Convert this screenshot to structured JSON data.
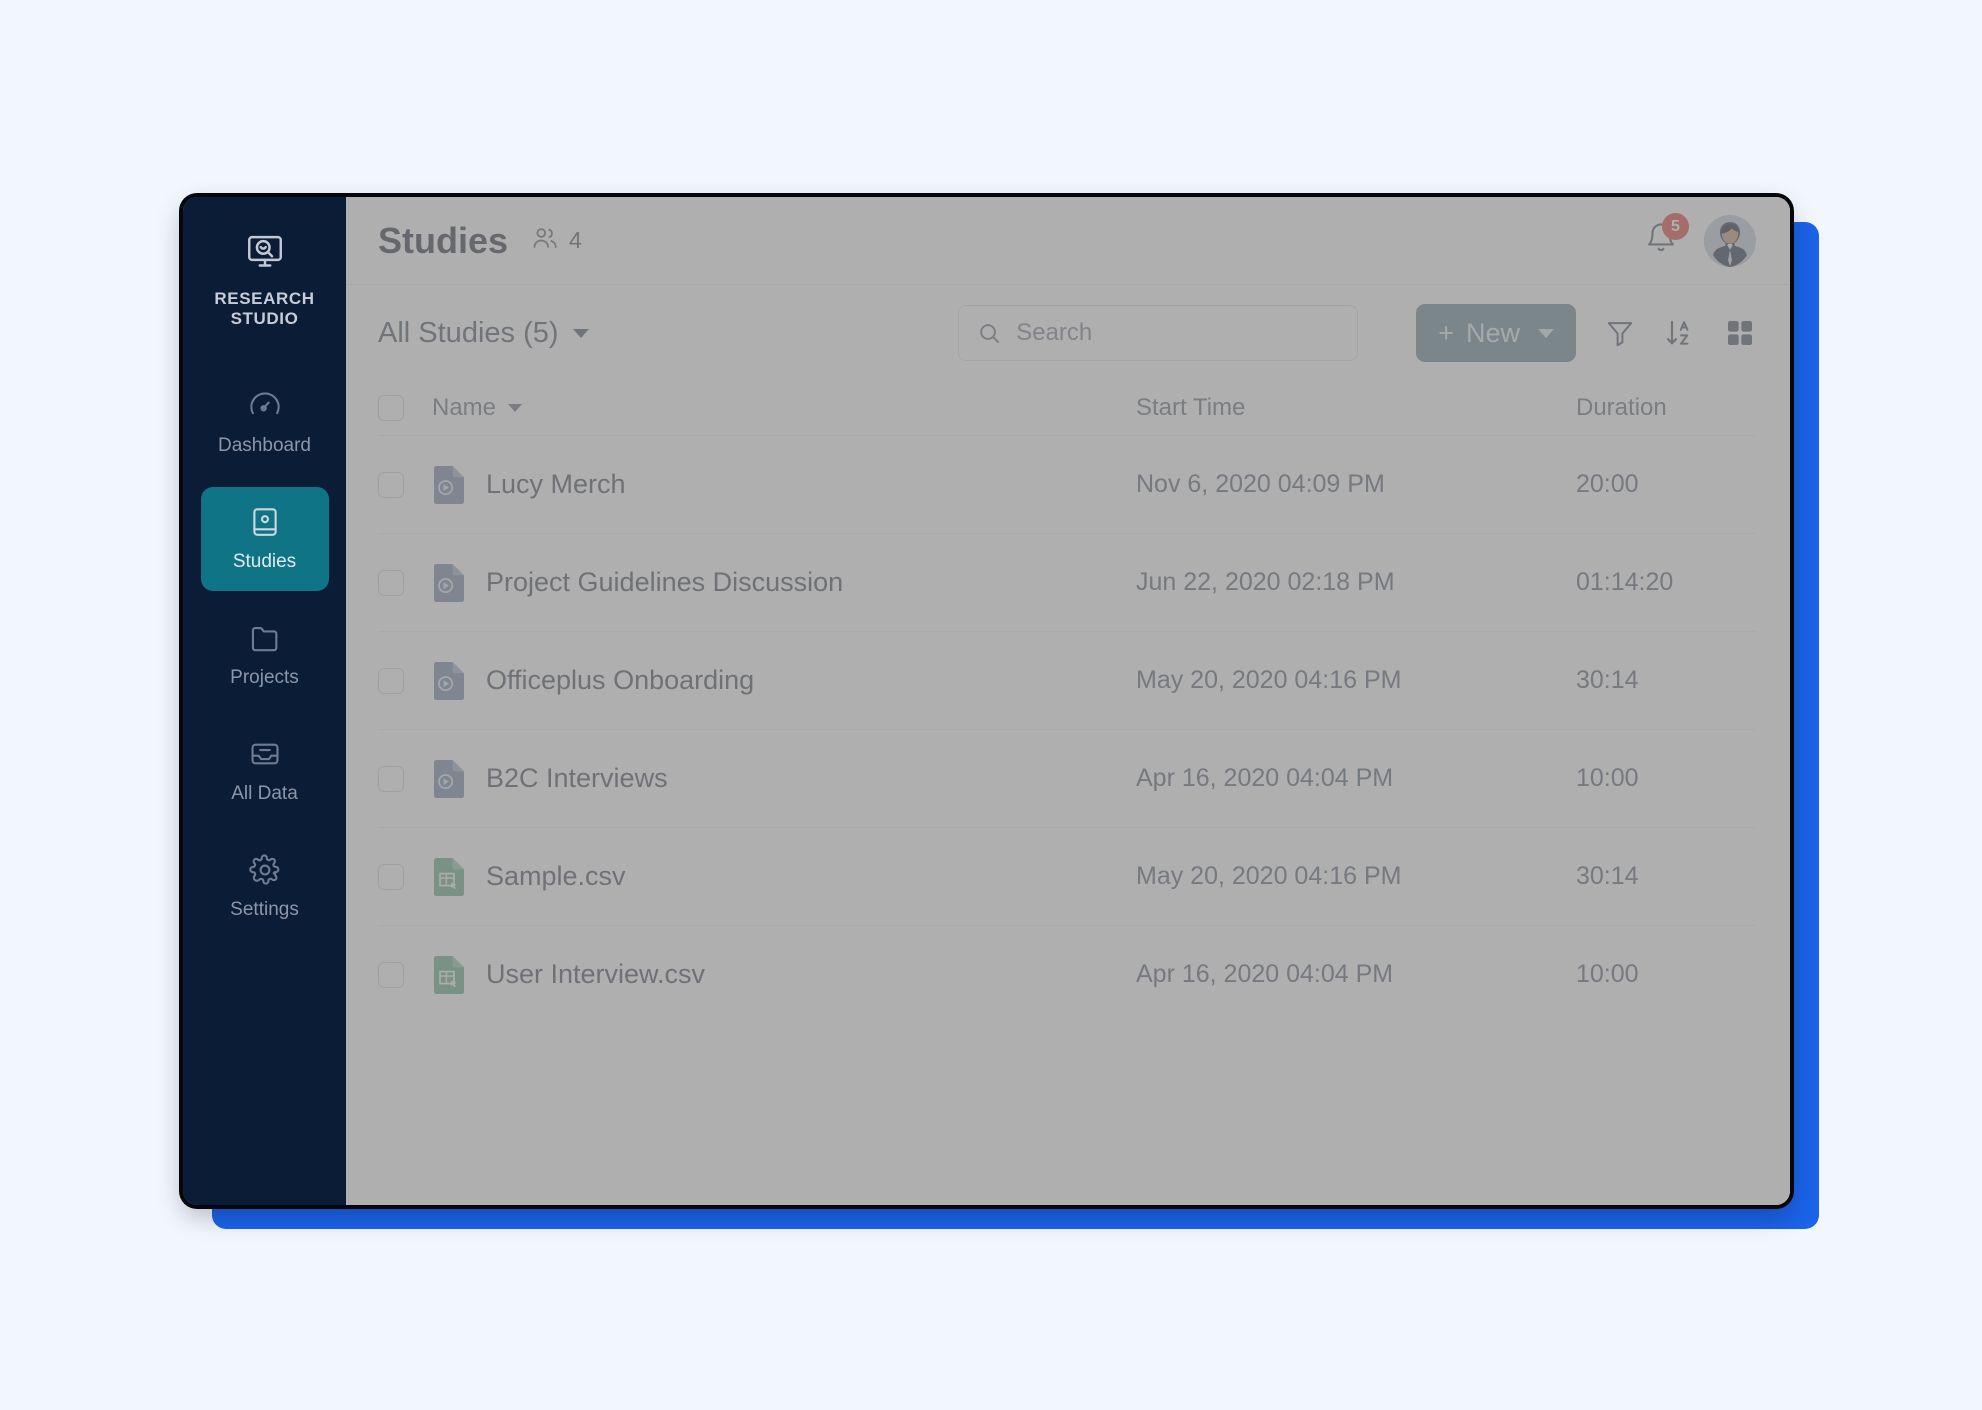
{
  "sidebar": {
    "brand": {
      "name": "RESEARCH\nSTUDIO",
      "icon": "research-studio-logo-icon"
    },
    "items": [
      {
        "label": "Dashboard",
        "icon": "speedometer-icon",
        "active": false
      },
      {
        "label": "Studies",
        "icon": "book-icon",
        "active": true
      },
      {
        "label": "Projects",
        "icon": "folder-icon",
        "active": false
      },
      {
        "label": "All Data",
        "icon": "inbox-icon",
        "active": false
      },
      {
        "label": "Settings",
        "icon": "gear-icon",
        "active": false
      }
    ]
  },
  "header": {
    "title": "Studies",
    "members_icon": "people-icon",
    "members_count": "4",
    "bell_icon": "bell-icon",
    "notification_count": "5",
    "avatar_icon": "user-avatar"
  },
  "toolbar": {
    "filter_label": "All Studies (5)",
    "search": {
      "placeholder": "Search",
      "value": "",
      "icon": "search-icon"
    },
    "new_button": {
      "label": "New",
      "plus": "+",
      "icon": "chevron-down-icon"
    },
    "icons": [
      {
        "name": "filter-icon"
      },
      {
        "name": "sort-az-icon"
      },
      {
        "name": "grid-view-icon"
      }
    ]
  },
  "table": {
    "columns": [
      "Name",
      "Start Time",
      "Duration"
    ],
    "rows": [
      {
        "name": "Lucy Merch",
        "start_time": "Nov 6, 2020 04:09 PM",
        "duration": "20:00",
        "file_type": "video"
      },
      {
        "name": "Project Guidelines Discussion",
        "start_time": "Jun 22, 2020 02:18 PM",
        "duration": "01:14:20",
        "file_type": "video"
      },
      {
        "name": "Officeplus Onboarding",
        "start_time": "May 20, 2020 04:16 PM",
        "duration": "30:14",
        "file_type": "video"
      },
      {
        "name": "B2C Interviews",
        "start_time": "Apr 16, 2020 04:04 PM",
        "duration": "10:00",
        "file_type": "video"
      },
      {
        "name": "Sample.csv",
        "start_time": "May 20, 2020 04:16 PM",
        "duration": "30:14",
        "file_type": "csv"
      },
      {
        "name": "User Interview.csv",
        "start_time": "Apr 16, 2020 04:04 PM",
        "duration": "10:00",
        "file_type": "csv"
      }
    ]
  },
  "colors": {
    "page_background": "#f2f6fd",
    "accent_blue": "#1b63e8",
    "sidebar": "#0b1c37",
    "active_nav": "#0f7586",
    "new_button": "#74939c",
    "badge_red": "#e45347",
    "video_icon": "#8094b0",
    "csv_icon": "#73b393"
  }
}
